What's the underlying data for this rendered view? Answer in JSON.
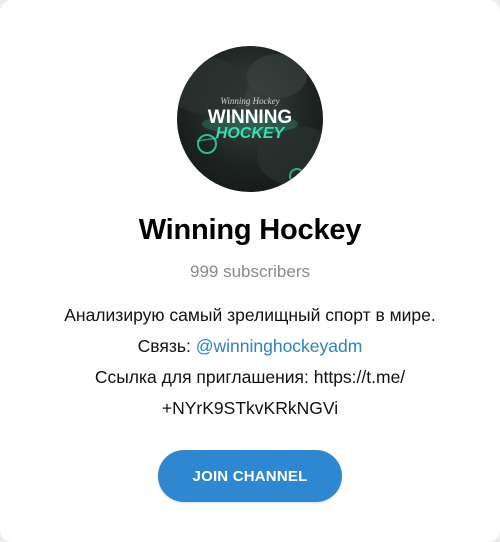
{
  "channel": {
    "avatar_text_small": "Winning Hockey",
    "avatar_text_line1": "WINNING",
    "avatar_text_line2": "HOCKEY",
    "name": "Winning Hockey",
    "subscribers": "999 subscribers",
    "description": {
      "line1": "Анализирую самый зрелищный спорт в мире.",
      "line2_prefix": "Связь: ",
      "line2_link": "@winninghockeyadm",
      "line3": "Ссылка для приглашения: https://t.me/",
      "line4": "+NYrK9STkvKRkNGVi"
    },
    "join_label": "JOIN CHANNEL"
  },
  "colors": {
    "accent": "#2e87d0",
    "link": "#2a82c9",
    "avatar_glow": "#36e0b0"
  }
}
